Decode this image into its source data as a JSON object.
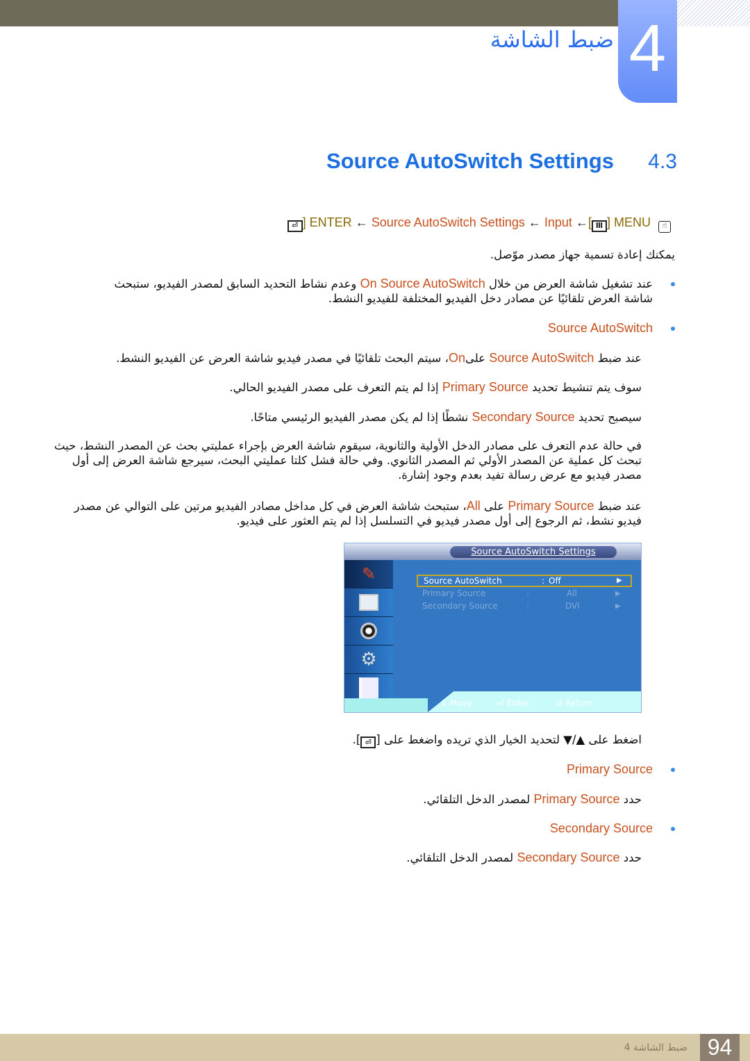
{
  "header": {
    "chapter_number": "4",
    "chapter_title": "ضبط الشاشة"
  },
  "section": {
    "number": "4.3",
    "title": "Source AutoSwitch Settings"
  },
  "menu_path": {
    "menu_label": "MENU",
    "menu_key": "Ⅲ",
    "arrow": "←",
    "items": [
      "Input",
      "Source AutoSwitch Settings"
    ],
    "enter_label": "ENTER"
  },
  "intro": [
    {
      "t": "يمكنك إعادة تسمية جهاز مصدر موّصل."
    }
  ],
  "bullet1": [
    {
      "t": "عند تشغيل شاشة العرض من خلال "
    },
    {
      "t": "On Source AutoSwitch",
      "hl": true
    },
    {
      "t": " وعدم نشاط التحديد السابق لمصدر الفيديو، ستبحث شاشة العرض تلقائيًا عن مصادر دخل الفيديو المختلفة للفيديو النشط."
    }
  ],
  "bullet2_title": "Source AutoSwitch",
  "p1": [
    {
      "t": "عند ضبط "
    },
    {
      "t": "Source AutoSwitch",
      "hl": true
    },
    {
      "t": " على"
    },
    {
      "t": "On",
      "hl": true
    },
    {
      "t": "، سيتم البحث تلقائيًا في مصدر فيديو شاشة العرض عن الفيديو النشط."
    }
  ],
  "p2": [
    {
      "t": "سوف يتم تنشيط تحديد "
    },
    {
      "t": "Primary Source",
      "hl": true
    },
    {
      "t": " إذا لم يتم التعرف على مصدر الفيديو الحالي."
    }
  ],
  "p3": [
    {
      "t": "سيصبح تحديد "
    },
    {
      "t": "Secondary Source",
      "hl": true
    },
    {
      "t": " نشطًا إذا لم يكن مصدر الفيديو الرئيسي متاحًا."
    }
  ],
  "p4": [
    {
      "t": "في حالة عدم التعرف على مصادر الدخل الأولية والثانوية، سيقوم شاشة العرض بإجراء عمليتي بحث عن المصدر النشط، حيث تبحث كل عملية عن المصدر الأولي ثم المصدر الثانوي. وفي حالة فشل كلتا عمليتي البحث، سيرجع شاشة العرض إلى أول مصدر فيديو مع عرض رسالة تفيد بعدم وجود إشارة."
    }
  ],
  "p5": [
    {
      "t": "عند ضبط "
    },
    {
      "t": "Primary Source",
      "hl": true
    },
    {
      "t": " على "
    },
    {
      "t": "All",
      "hl": true
    },
    {
      "t": "، ستبحث شاشة العرض في كل مداخل مصادر الفيديو مرتين على التوالي عن مصدر فيديو نشط، ثم الرجوع إلى أول مصدر فيديو في التسلسل إذا لم يتم العثور على فيديو."
    }
  ],
  "osd": {
    "title": "Source AutoSwitch Settings",
    "rows": [
      {
        "label": "Source AutoSwitch",
        "sep": ":",
        "value": "Off",
        "arrow": "▶"
      },
      {
        "label": "Primary Source",
        "sep": ":",
        "value": "All",
        "arrow": "▶"
      },
      {
        "label": "Secondary Source",
        "sep": ":",
        "value": "DVI",
        "arrow": "▶"
      }
    ],
    "footer": {
      "move": "Move",
      "enter": "Enter",
      "return": "Return"
    }
  },
  "instruction": [
    {
      "t": "اضغط على ▲/▼ لتحديد الخيار الذي تريده واضغط على ["
    },
    {
      "t": "⏎",
      "key": true
    },
    {
      "t": "]."
    }
  ],
  "bullet3_title": "Primary Source",
  "p6": [
    {
      "t": "حدد "
    },
    {
      "t": "Primary Source",
      "hl": true
    },
    {
      "t": " لمصدر الدخل التلقائي."
    }
  ],
  "bullet4_title": "Secondary Source",
  "p7": [
    {
      "t": "حدد "
    },
    {
      "t": "Secondary Source",
      "hl": true
    },
    {
      "t": " لمصدر الدخل التلقائي."
    }
  ],
  "footer": {
    "text": "ضبط الشاشة 4",
    "page": "94"
  },
  "colors": {
    "accent_blue": "#1b6fe0",
    "highlight_orange": "#c8501e",
    "key_gold": "#8a6a00",
    "header_bar": "#6e6b58",
    "footer_band": "#d6c9a8"
  }
}
